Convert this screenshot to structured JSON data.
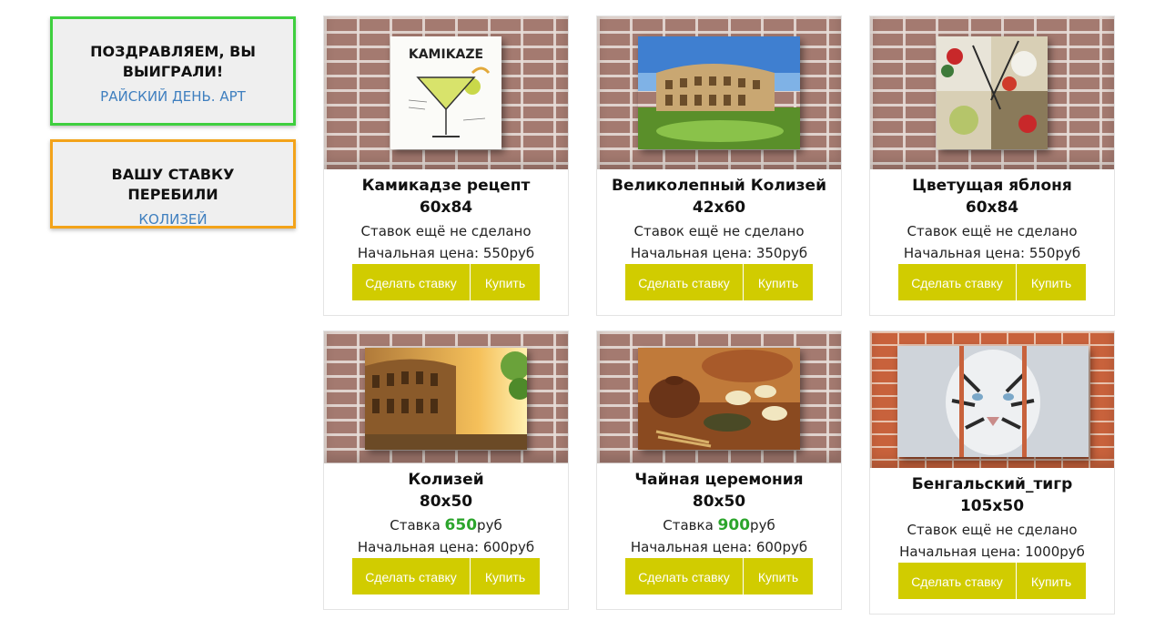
{
  "notices": {
    "won": {
      "title": "ПОЗДРАВЛЯЕМ, ВЫ ВЫИГРАЛИ!",
      "link": "РАЙСКИЙ ДЕНЬ. АРТ",
      "color": "#3fcf3f"
    },
    "outbid": {
      "title": "ВАШУ СТАВКУ ПЕРЕБИЛИ",
      "link": "КОЛИЗЕЙ",
      "color": "#f3a31a"
    }
  },
  "buttons": {
    "bid": "Сделать ставку",
    "buy": "Купить",
    "color": "#d1cc00"
  },
  "products": [
    {
      "title": "Камикадзе рецепт",
      "size": "60x84",
      "status": "Ставок ещё не сделано",
      "start": "Начальная цена: 550руб"
    },
    {
      "title": "Великолепный Колизей",
      "size": "42x60",
      "status": "Ставок ещё не сделано",
      "start": "Начальная цена: 350руб"
    },
    {
      "title": "Цветущая яблоня",
      "size": "60x84",
      "status": "Ставок ещё не сделано",
      "start": "Начальная цена: 550руб"
    },
    {
      "title": "Колизей",
      "size": "80x50",
      "bid_prefix": "Ставка ",
      "bid_amount": "650",
      "bid_suffix": "руб",
      "start": "Начальная цена: 600руб"
    },
    {
      "title": "Чайная церемония",
      "size": "80x50",
      "bid_prefix": "Ставка ",
      "bid_amount": "900",
      "bid_suffix": "руб",
      "start": "Начальная цена: 600руб"
    },
    {
      "title": "Бенгальский_тигр",
      "size": "105x50",
      "status": "Ставок ещё не сделано",
      "start": "Начальная цена: 1000руб"
    }
  ],
  "art_text": {
    "kamikaze": "KAMIKAZE"
  }
}
